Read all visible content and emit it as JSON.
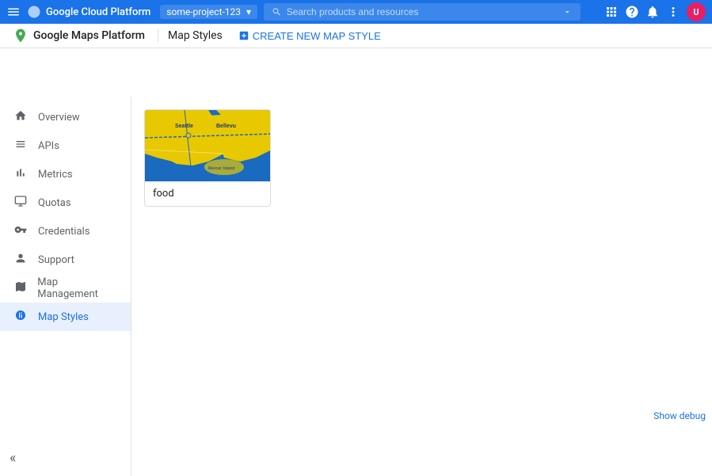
{
  "topbar": {
    "menu_icon": "☰",
    "title": "Google Cloud Platform",
    "project": "some-project-123",
    "search_placeholder": "Search products and resources",
    "icons": {
      "apps": "⊞",
      "help": "?",
      "bell": "🔔",
      "dots": "⋮"
    }
  },
  "secondbar": {
    "maps_title": "Google Maps Platform",
    "page_title": "Map Styles",
    "create_btn": "CREATE NEW MAP STYLE"
  },
  "sidebar": {
    "items": [
      {
        "id": "overview",
        "label": "Overview",
        "icon": "home"
      },
      {
        "id": "apis",
        "label": "APIs",
        "icon": "list"
      },
      {
        "id": "metrics",
        "label": "Metrics",
        "icon": "bar_chart"
      },
      {
        "id": "quotas",
        "label": "Quotas",
        "icon": "monitor"
      },
      {
        "id": "credentials",
        "label": "Credentials",
        "icon": "key"
      },
      {
        "id": "support",
        "label": "Support",
        "icon": "person"
      },
      {
        "id": "map_management",
        "label": "Map Management",
        "icon": "layers"
      },
      {
        "id": "map_styles",
        "label": "Map Styles",
        "icon": "palette",
        "active": true
      }
    ],
    "collapse_icon": "«"
  },
  "main": {
    "map_style_card": {
      "label": "food"
    }
  },
  "footer": {
    "show_debug": "Show debug"
  }
}
